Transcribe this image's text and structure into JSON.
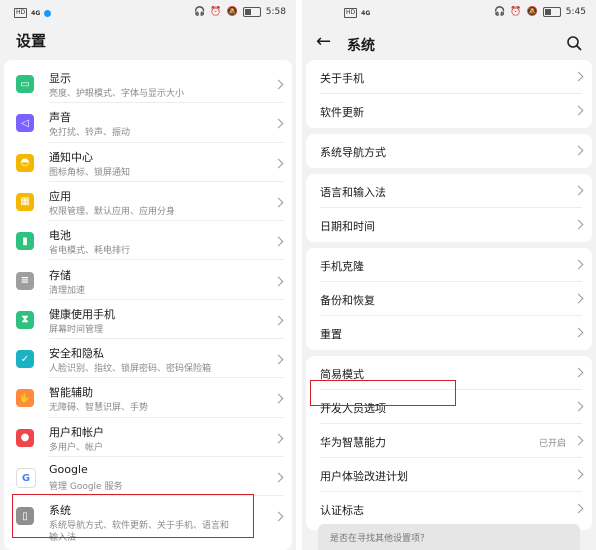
{
  "left": {
    "status": {
      "network": "HD",
      "signal": "4G",
      "time": "5:58"
    },
    "title": "设置",
    "items": [
      {
        "label": "显示",
        "sub": "亮度、护眼模式、字体与显示大小",
        "icon": "display-icon",
        "color": "#2ec27e"
      },
      {
        "label": "声音",
        "sub": "免打扰、铃声、振动",
        "icon": "sound-icon",
        "color": "#7b61ff"
      },
      {
        "label": "通知中心",
        "sub": "图标角标、锁屏通知",
        "icon": "notification-bell-icon",
        "color": "#f5b800"
      },
      {
        "label": "应用",
        "sub": "权限管理、默认应用、应用分身",
        "icon": "apps-grid-icon",
        "color": "#f5b800"
      },
      {
        "label": "电池",
        "sub": "省电模式、耗电排行",
        "icon": "battery-icon",
        "color": "#2ec27e"
      },
      {
        "label": "存储",
        "sub": "清理加速",
        "icon": "storage-icon",
        "color": "#9e9e9e"
      },
      {
        "label": "健康使用手机",
        "sub": "屏幕时间管理",
        "icon": "hourglass-icon",
        "color": "#2ec27e"
      },
      {
        "label": "安全和隐私",
        "sub": "人脸识别、指纹、锁屏密码、密码保险箱",
        "icon": "shield-check-icon",
        "color": "#1bb3c4"
      },
      {
        "label": "智能辅助",
        "sub": "无障碍、智慧识屏、手势",
        "icon": "hand-icon",
        "color": "#ff8a3d"
      },
      {
        "label": "用户和帐户",
        "sub": "多用户、帐户",
        "icon": "user-icon",
        "color": "#f0454a"
      },
      {
        "label": "Google",
        "sub": "管理 Google 服务",
        "icon": "google-logo-icon",
        "color": "#ffffff"
      },
      {
        "label": "系统",
        "sub": "系统导航方式、软件更新、关于手机、语言和",
        "sub2": "输入法",
        "icon": "system-icon",
        "color": "#8f8f8f"
      }
    ]
  },
  "right": {
    "status": {
      "network": "HD",
      "signal": "4G",
      "time": "5:45"
    },
    "title": "系统",
    "groups": [
      [
        {
          "label": "关于手机"
        },
        {
          "label": "软件更新"
        }
      ],
      [
        {
          "label": "系统导航方式"
        }
      ],
      [
        {
          "label": "语言和输入法"
        },
        {
          "label": "日期和时间"
        }
      ],
      [
        {
          "label": "手机克隆"
        },
        {
          "label": "备份和恢复"
        },
        {
          "label": "重置"
        }
      ],
      [
        {
          "label": "简易模式"
        },
        {
          "label": "开发人员选项"
        },
        {
          "label": "华为智慧能力",
          "value": "已开启"
        },
        {
          "label": "用户体验改进计划"
        },
        {
          "label": "认证标志"
        }
      ]
    ],
    "hint": "是否在寻找其他设置项？"
  },
  "colors": {
    "highlight": "#d21f2b",
    "background": "#f2f2f2"
  }
}
